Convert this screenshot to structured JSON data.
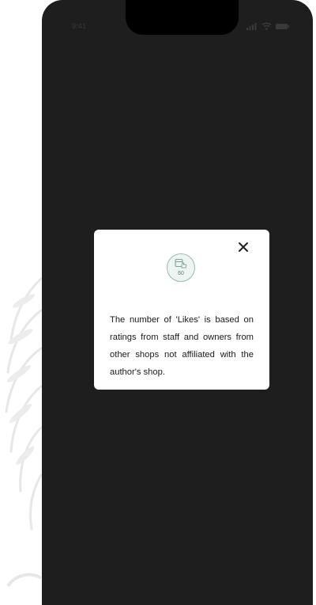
{
  "status_bar": {
    "time": "9:41",
    "icons": [
      "signal-icon",
      "wifi-icon",
      "battery-icon"
    ]
  },
  "modal": {
    "close_icon": "close-icon",
    "badge_icon": "like-store-icon",
    "like_count": "60",
    "message": "The number of 'Likes' is based on ratings from staff and owners from other shops not affiliated with the author's shop."
  },
  "colors": {
    "overlay": "#1e1e1e",
    "modal_background": "#ffffff",
    "badge_accent": "#9bb9ad",
    "text": "#1a1a1a"
  }
}
